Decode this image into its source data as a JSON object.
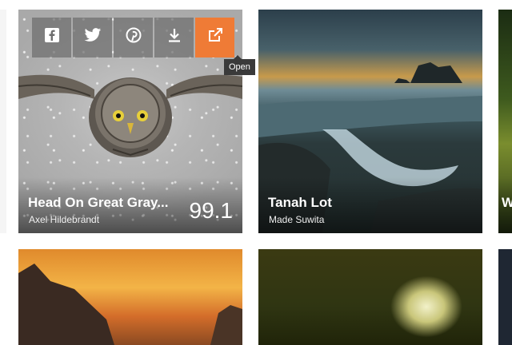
{
  "cards": [
    {
      "title": "Head On Great Gray...",
      "author": "Axel Hildebrandt",
      "score": "99.1"
    },
    {
      "title": "Tanah Lot",
      "author": "Made Suwita"
    },
    {
      "title": "W"
    }
  ],
  "toolbar": {
    "icons": [
      "facebook-icon",
      "twitter-icon",
      "pinterest-icon",
      "download-icon",
      "open-external-icon"
    ],
    "open_tooltip": "Open"
  },
  "colors": {
    "open_button": "#ef7b36"
  }
}
